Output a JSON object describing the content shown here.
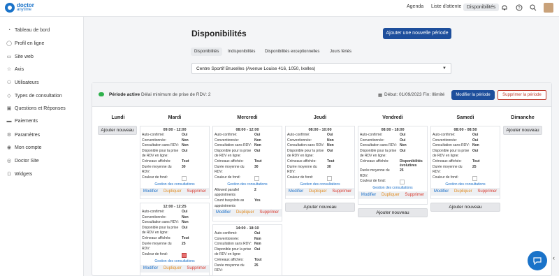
{
  "brand": {
    "name": "doctor",
    "sub": "anytime"
  },
  "topnav": {
    "agenda": "Agenda",
    "waitlist": "Liste d'attente",
    "availability": "Disponibilités"
  },
  "sidebar": {
    "items": [
      "Tableau de bord",
      "Profil en ligne",
      "Site web",
      "Avis",
      "Utilisateurs",
      "Types de consultation",
      "Questions et Réponses",
      "Paiements",
      "Paramètres",
      "Mon compte",
      "Doctor Site",
      "Widgets"
    ]
  },
  "page": {
    "title": "Disponibilités",
    "add_period": "Ajouter une nouvelle période"
  },
  "tabs": [
    "Disponibilités",
    "Indisponibilités",
    "Disponibilités exceptionnelles",
    "Jours fériés"
  ],
  "location": {
    "selected": "Centre Sportif Bruxelles (Avenue Louise 416, 1050, Ixelles)"
  },
  "period": {
    "status": "Période active",
    "delay": "Délai minimum de prise de RDV: 2",
    "dates": "Début: 01/09/2023 Fin: Illimité",
    "edit": "Modifier la période",
    "delete": "Supprimer la période"
  },
  "labels": {
    "add": "Ajouter nouveau",
    "manage": "Gestion des consultations",
    "modify": "Modifier",
    "duplicate": "Dupliquer",
    "remove": "Supprimer"
  },
  "days": [
    "Lundi",
    "Mardi",
    "Mercredi",
    "Jeudi",
    "Vendredi",
    "Samedi",
    "Dimanche"
  ],
  "fields": {
    "auto": "Auto-confirmé:",
    "conv": "Conventionnée:",
    "sans": "Consultation sans RDV:",
    "dispo1": "Disponible pour la prise",
    "dispo2": "de RDV en ligne:",
    "cren": "Créneaux affichés:",
    "duree1": "Durée moyenne du",
    "duree2": "RDV:",
    "color": "Couleur de fond:",
    "parallel1": "Allowed parallel",
    "parallel2": "appointments",
    "busy1": "Count busyslots as",
    "busy2": "appointments"
  },
  "slots": {
    "mardi1": {
      "time": "09:00 - 12:00",
      "auto": "Oui",
      "conv": "Non",
      "sans": "Non",
      "dispo": "Oui",
      "cren": "Tout",
      "duree": "30"
    },
    "mardi2": {
      "time": "12:00 - 12:25",
      "auto": "Oui",
      "conv": "Non",
      "sans": "Non",
      "dispo": "Oui",
      "cren": "Tout",
      "duree": "25"
    },
    "mer1": {
      "time": "08:00 - 12:00",
      "auto": "Oui",
      "conv": "Non",
      "sans": "Non",
      "dispo": "Oui",
      "cren": "Tout",
      "duree": "30",
      "parallel": "2",
      "busy": "Yes"
    },
    "mer2": {
      "time": "14:00 - 18:10",
      "auto": "Oui",
      "conv": "Non",
      "sans": "Non",
      "dispo": "Oui",
      "cren": "Tout",
      "duree": "25"
    },
    "jeudi1": {
      "time": "08:00 - 10:00",
      "auto": "Oui",
      "conv": "Non",
      "sans": "Non",
      "dispo": "Oui",
      "cren": "Tout",
      "duree": "30"
    },
    "ven1": {
      "time": "08:00 - 18:00",
      "auto": "Oui",
      "conv": "Oui",
      "sans": "Non",
      "dispo": "Oui",
      "cren": "Disponibilités évolutives",
      "duree": "25"
    },
    "sam1": {
      "time": "08:00 - 08:50",
      "auto": "Oui",
      "conv": "Oui",
      "sans": "Non",
      "dispo": "Oui",
      "cren": "Tout",
      "duree": "25"
    }
  }
}
